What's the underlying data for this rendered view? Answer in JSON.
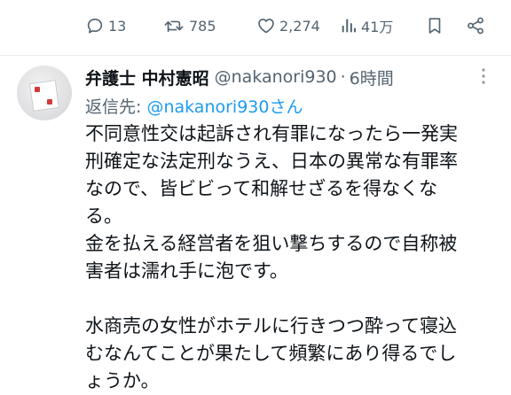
{
  "actions": {
    "reply": {
      "icon": "reply-icon",
      "count": "13"
    },
    "repost": {
      "icon": "repost-icon",
      "count": "785"
    },
    "like": {
      "icon": "like-icon",
      "count": "2,274"
    },
    "views": {
      "icon": "views-icon",
      "count": "41万"
    },
    "bookmark": {
      "icon": "bookmark-icon"
    },
    "share": {
      "icon": "share-icon"
    }
  },
  "tweet": {
    "author_name": "弁護士 中村憲昭",
    "handle": "@nakanori930",
    "separator": "·",
    "time": "6時間",
    "reply_to_label": "返信先: ",
    "reply_to_mention": "@nakanori930さん",
    "body_lines": [
      "不同意性交は起訴され有罪になったら一発実",
      "刑確定な法定刑なうえ、日本の異常な有罪率",
      "なので、皆ビビって和解せざるを得なくな",
      "る。",
      "金を払える経営者を狙い撃ちするので自称被",
      "害者は濡れ手に泡です。",
      "",
      "水商売の女性がホテルに行きつつ酔って寝込",
      "むなんてことが果たして頻繁にあり得るでし",
      "ょうか。"
    ]
  },
  "colors": {
    "text": "#0f1419",
    "secondary": "#536471",
    "link": "#1d9bf0",
    "divider": "#e6ecf0"
  }
}
